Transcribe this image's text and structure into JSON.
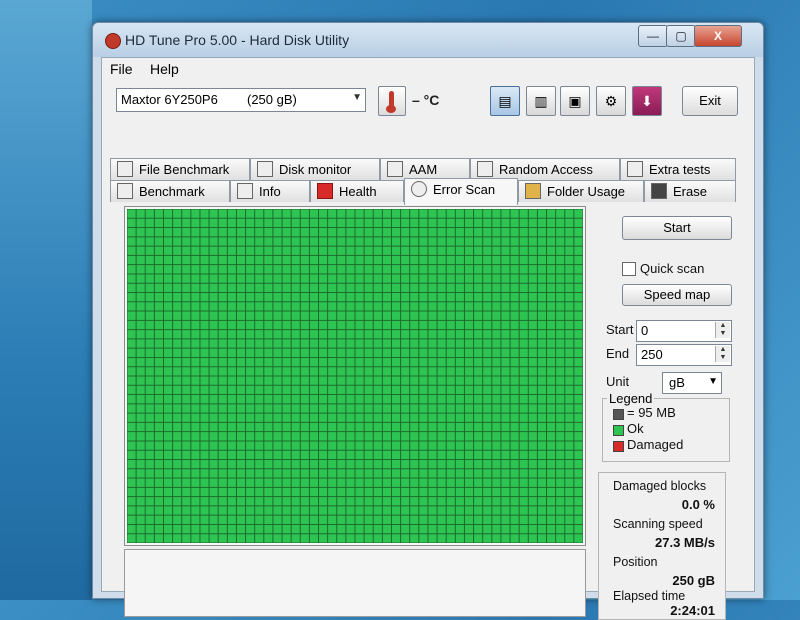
{
  "window": {
    "title": "HD Tune Pro 5.00 - Hard Disk Utility"
  },
  "titlebar": {
    "minimize": "—",
    "maximize": "▢",
    "close": "X"
  },
  "menu": {
    "file": "File",
    "help": "Help"
  },
  "drive": {
    "name": "Maxtor 6Y250P6",
    "size": "(250 gB)"
  },
  "temperature": {
    "text": "– °C"
  },
  "toolbar": {
    "exit": "Exit",
    "icons": [
      "copy-info-icon",
      "copy-text-icon",
      "save-icon",
      "options-icon",
      "download-icon"
    ]
  },
  "tabs": {
    "top": [
      {
        "label": "File Benchmark",
        "icon": "file-benchmark-icon"
      },
      {
        "label": "Disk monitor",
        "icon": "disk-monitor-icon"
      },
      {
        "label": "AAM",
        "icon": "speaker-icon"
      },
      {
        "label": "Random Access",
        "icon": "random-access-icon"
      },
      {
        "label": "Extra tests",
        "icon": "extra-tests-icon"
      }
    ],
    "bottom": [
      {
        "label": "Benchmark",
        "icon": "benchmark-icon"
      },
      {
        "label": "Info",
        "icon": "info-icon"
      },
      {
        "label": "Health",
        "icon": "health-icon"
      },
      {
        "label": "Error Scan",
        "icon": "magnifier-icon",
        "active": true
      },
      {
        "label": "Folder Usage",
        "icon": "folder-icon"
      },
      {
        "label": "Erase",
        "icon": "trash-icon"
      }
    ]
  },
  "scan": {
    "start_button": "Start",
    "quick_scan": "Quick scan",
    "quick_scan_checked": false,
    "speed_map_button": "Speed map",
    "start_label": "Start",
    "start_value": "0",
    "end_label": "End",
    "end_value": "250",
    "unit_label": "Unit",
    "unit_value": "gB",
    "grid_color_ok": "#2ec452",
    "grid_cells_state": "all-ok"
  },
  "legend": {
    "title": "Legend",
    "items": [
      {
        "label": "= 95 MB",
        "color": "#555555"
      },
      {
        "label": "Ok",
        "color": "#2ec452"
      },
      {
        "label": "Damaged",
        "color": "#d92a2a"
      }
    ]
  },
  "stats": {
    "damaged_blocks_label": "Damaged blocks",
    "damaged_blocks_value": "0.0 %",
    "scanning_speed_label": "Scanning speed",
    "scanning_speed_value": "27.3 MB/s",
    "position_label": "Position",
    "position_value": "250 gB",
    "elapsed_label": "Elapsed time",
    "elapsed_value": "2:24:01"
  }
}
